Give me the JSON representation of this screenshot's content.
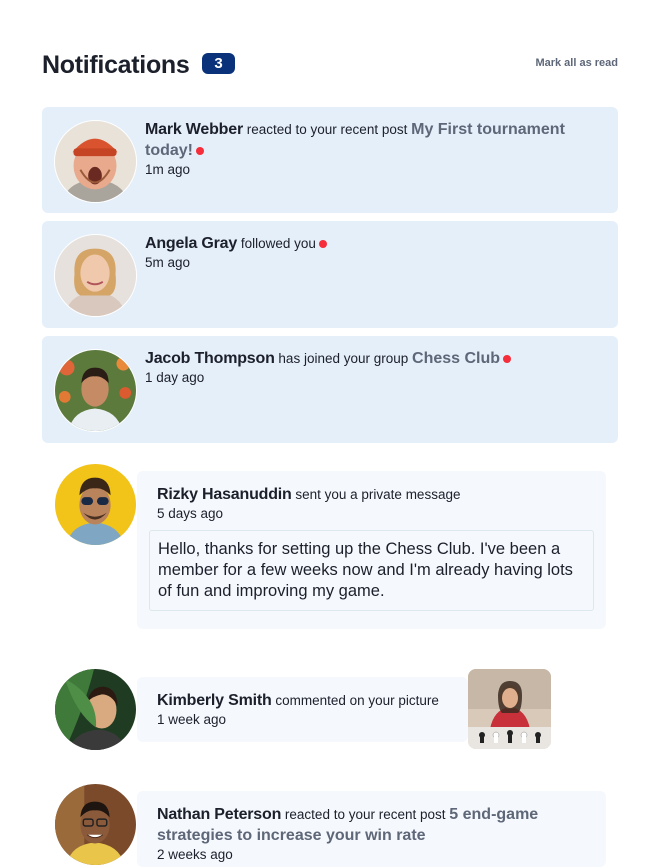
{
  "header": {
    "title": "Notifications",
    "count": "3",
    "mark_all": "Mark all as read"
  },
  "notifications": [
    {
      "name": "Mark Webber",
      "action": "reacted to your recent post",
      "target": "My First tournament today!",
      "time": "1m ago",
      "unread": true
    },
    {
      "name": "Angela Gray",
      "action": "followed you",
      "time": "5m ago",
      "unread": true
    },
    {
      "name": "Jacob Thompson",
      "action": "has joined your group",
      "target": "Chess Club",
      "time": "1 day ago",
      "unread": true
    },
    {
      "name": "Rizky Hasanuddin",
      "action": "sent you a private message",
      "time": "5 days ago",
      "message": "Hello, thanks for setting up the Chess Club. I've been a member for a few weeks now and I'm already having lots of fun and improving my game.",
      "unread": false
    },
    {
      "name": "Kimberly Smith",
      "action": "commented on your picture",
      "time": "1 week ago",
      "unread": false
    },
    {
      "name": "Nathan Peterson",
      "action": "reacted to your recent post",
      "target": "5 end-game strategies to increase your win rate",
      "time": "2 weeks ago",
      "unread": false
    }
  ],
  "colors": {
    "badge": "#0a327b",
    "unread_bg": "#e5effa",
    "read_bg": "#f5f8fd",
    "dot": "#f62d3a",
    "muted": "#5e6778"
  }
}
